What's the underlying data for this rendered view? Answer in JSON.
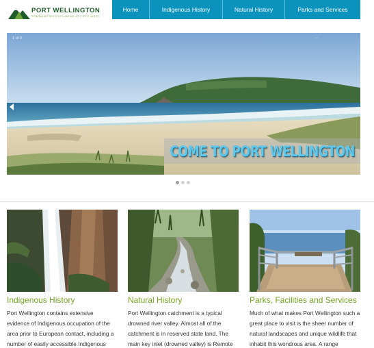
{
  "logo": {
    "title": "PORT WELLINGTON",
    "tagline": "COMMUNITIES EXPLORING ETC ETC WEST"
  },
  "nav": {
    "items": [
      {
        "label": "Home"
      },
      {
        "label": "Indigenous History"
      },
      {
        "label": "Natural History"
      },
      {
        "label": "Parks and Services"
      }
    ]
  },
  "slider": {
    "counter": "1 of 3",
    "more": "...",
    "caption": "COME TO PORT WELLINGTON",
    "slide_count": 3,
    "active_slide": 1
  },
  "features": [
    {
      "title": "Indigenous History",
      "text": "Port Wellington contains extensive evidence of Indigenous occupation of the area prior to European contact, including a number of easily accessible Indigenous"
    },
    {
      "title": "Natural History",
      "text": "Port Wellington catchment is a typical drowned river valley. Almost all of the catchment is in reserved state land. The main key inlet (drowned valley) is Remote"
    },
    {
      "title": "Parks, Facilities and Services",
      "text": "Much of what makes Port Wellington such a great place to visit is the sheer number of natural landscapes and unique wildlife that inhabit this wondrous area. A range"
    }
  ],
  "colors": {
    "nav_bg": "#0b93be",
    "heading_green": "#74a51e",
    "caption_blue": "#5ec7ec"
  },
  "icons": {
    "logo": "mountain-logo-icon",
    "prev": "arrow-left-icon"
  }
}
